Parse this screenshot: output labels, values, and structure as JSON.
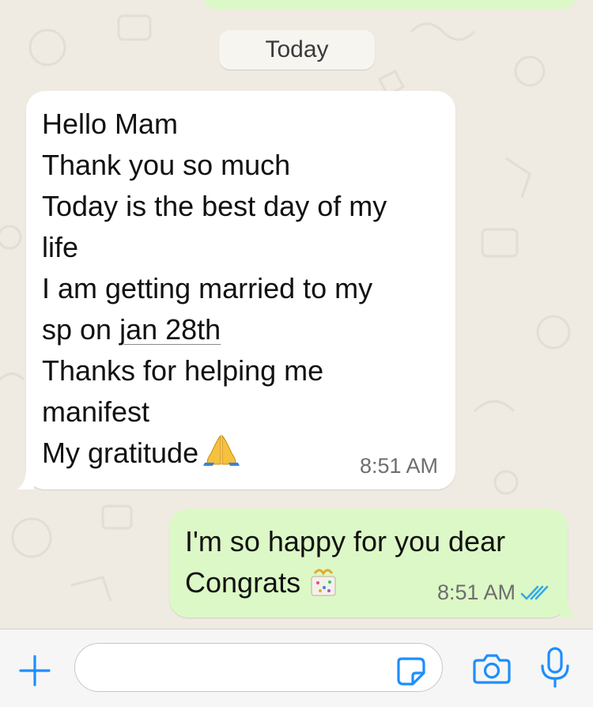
{
  "colors": {
    "chat_background": "#EFEAE2",
    "incoming_bubble": "#FFFFFF",
    "outgoing_bubble": "#DCF8C6",
    "accent_blue": "#1D8EFF",
    "read_ticks": "#34A9E6"
  },
  "date_separator": "Today",
  "messages": [
    {
      "direction": "incoming",
      "lines": {
        "l1": "Hello Mam",
        "l2": "Thank you so much",
        "l3": "Today is the best day of my",
        "l4": "life",
        "l5": "I am getting married to my",
        "l6_prefix": "sp on ",
        "l6_link": "jan 28th",
        "l7": "Thanks for helping me",
        "l8": "manifest",
        "l9": "My gratitude"
      },
      "emoji": "folded-hands",
      "time": "8:51 AM"
    },
    {
      "direction": "outgoing",
      "lines": {
        "l1": "I'm so happy for you dear",
        "l2": "Congrats"
      },
      "emoji": "confetti-gift",
      "time": "8:51 AM",
      "status": "read"
    }
  ],
  "composer": {
    "placeholder": "",
    "icons": [
      "plus-icon",
      "sticker-icon",
      "camera-icon",
      "microphone-icon"
    ]
  }
}
